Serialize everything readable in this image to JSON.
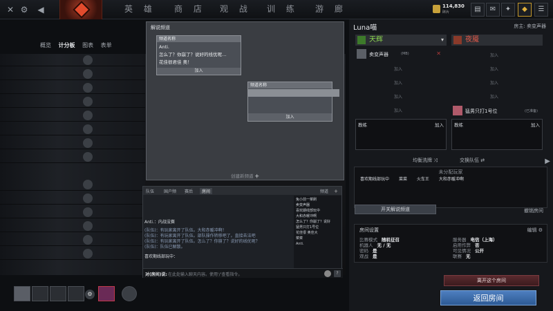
{
  "topbar": {
    "nav": [
      "英 雄",
      "商 店",
      "观 战",
      "训 练",
      "游 廊"
    ],
    "coins_value": "114,830",
    "coins_label": "碎片",
    "icons": [
      "close-icon",
      "gear-icon",
      "back-icon",
      "inventory-icon",
      "mail-icon",
      "dota-plus-icon",
      "gem-icon"
    ]
  },
  "subnav": {
    "items": [
      "概览",
      "计分板",
      "图表",
      "表单"
    ],
    "active": "计分板"
  },
  "caster_panel": {
    "title": "解说频道",
    "card1": {
      "header": "频道名称",
      "line1": "Anti.",
      "line2": "怎么了？你崩了？说好的线优呢…",
      "line3": "花佳很君佳 奥！",
      "join": "加入"
    },
    "card2": {
      "header": "频道名称",
      "join": "加入"
    },
    "create": "创建新频道"
  },
  "chat": {
    "tabs": [
      "队伍",
      "国户频",
      "赛后",
      "房间"
    ],
    "right_tab": "频道",
    "log": [
      "Anti.：内战没赛",
      "(队伍)：有玩家离开了队伍。大和赤暖冲啊！",
      "(队伍)：有玩家离开了队伍。部队操作转移吧了。直接去法吧",
      "(队伍)：有玩家离开了队伍。怎么了？你崩了？说好的线优呢？",
      "(队伍)：队伍已解散。",
      "喜欢期线部玩中："
    ],
    "side_list": [
      "兔小前一菜刷",
      "卖变声器",
      "喜欢期线部玩中",
      "大和赤暖冲啊",
      "怎么了？你崩了？说好",
      "猛男只打1号位",
      "花佳很 奥佳大",
      "菜菜",
      "Anti."
    ],
    "input_label": "对(房间)说:",
    "input_placeholder": "在此处输入聊天内容。使用'/'查看指令。"
  },
  "lobby": {
    "name": "Luna喵",
    "host": "房主: 卖变声器",
    "radiant": "天辉",
    "dire": "夜魇",
    "radiant_slots": [
      {
        "name": "卖变声器",
        "tag": "(MB)"
      },
      {
        "join": "加入"
      },
      {
        "join": "加入"
      },
      {
        "join": "加入"
      },
      {
        "join": "加入"
      }
    ],
    "dire_slots": [
      {
        "join": "加入"
      },
      {
        "join": "加入"
      },
      {
        "join": "加入"
      },
      {
        "join": "加入"
      },
      {
        "name": "猛男只打1号位",
        "tag": "(已准备)"
      }
    ],
    "coach": "教练",
    "coach_join": "加入",
    "balance": "均衡洗牌",
    "swap": "交换队伍",
    "unassigned_header": "未分配玩家",
    "unassigned": [
      "喜欢期线部玩中",
      "菜菜",
      "火车王",
      "大和赤暖冲啊"
    ],
    "caster_btn": "开关解说频道",
    "delete_room": "撤销房间",
    "settings_header": "房间设置",
    "settings_edit": "编辑",
    "settings": [
      {
        "k": "比赛模式",
        "v": "随机征召"
      },
      {
        "k": "服务器",
        "v": "电信（上海）"
      },
      {
        "k": "机器人",
        "v": "无 / 无"
      },
      {
        "k": "启用作弊",
        "v": "否"
      },
      {
        "k": "密码",
        "v": "是"
      },
      {
        "k": "可见情况",
        "v": "公开"
      },
      {
        "k": "观战",
        "v": "是"
      },
      {
        "k": "联赛",
        "v": "无"
      }
    ],
    "leave_btn": "离开这个房间",
    "back_btn": "返回房间"
  },
  "colors": {
    "radiant": "#8bd64f",
    "dire": "#e55a4a",
    "accent": "#4e7fbf"
  }
}
